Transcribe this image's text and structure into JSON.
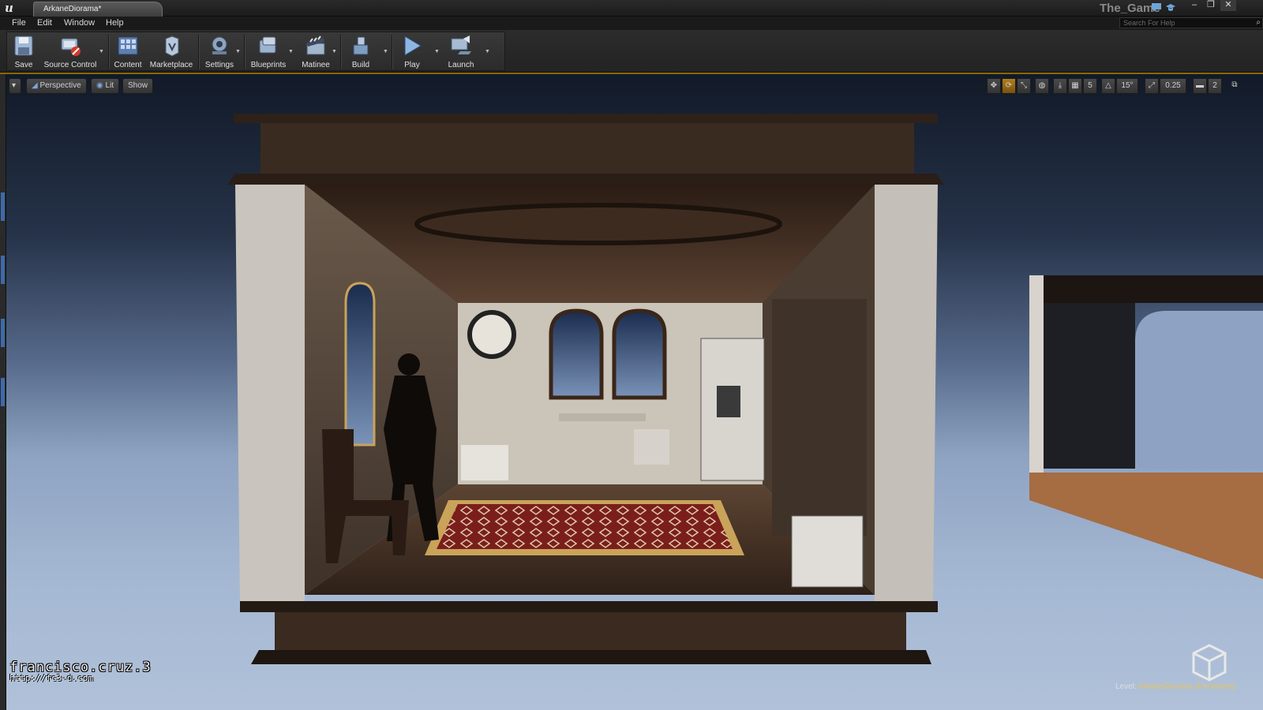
{
  "titlebar": {
    "document_tab": "ArkaneDiorama*",
    "project_name": "The_Game",
    "window_controls": [
      "–",
      "❐",
      "✕"
    ]
  },
  "menu": {
    "items": [
      "File",
      "Edit",
      "Window",
      "Help"
    ],
    "help_search_placeholder": "Search For Help"
  },
  "toolbar": {
    "tools": [
      {
        "label": "Save",
        "icon": "save-icon"
      },
      {
        "label": "Source Control",
        "icon": "source-control-icon"
      },
      {
        "label": "Content",
        "icon": "content-browser-icon"
      },
      {
        "label": "Marketplace",
        "icon": "marketplace-icon"
      },
      {
        "label": "Settings",
        "icon": "settings-icon"
      },
      {
        "label": "Blueprints",
        "icon": "blueprints-icon"
      },
      {
        "label": "Matinee",
        "icon": "matinee-icon"
      },
      {
        "label": "Build",
        "icon": "build-icon"
      },
      {
        "label": "Play",
        "icon": "play-icon"
      },
      {
        "label": "Launch",
        "icon": "launch-icon"
      }
    ]
  },
  "viewport": {
    "view_mode": "Perspective",
    "lighting_mode": "Lit",
    "show_label": "Show",
    "grid_snap": "5",
    "rotation_snap": "15°",
    "scale_snap": "0.25",
    "camera_speed": "2",
    "level_prefix": "Level:",
    "level_name": "ArkaneDiorama (Persistent)",
    "watermark_name": "francisco.cruz.3",
    "watermark_url": "http://fc3-d.com"
  },
  "colors": {
    "accent_rule": "#8a6a00",
    "level_name": "#e8c45c",
    "sky_top": "#121a28",
    "sky_bottom": "#b0c1d9"
  }
}
